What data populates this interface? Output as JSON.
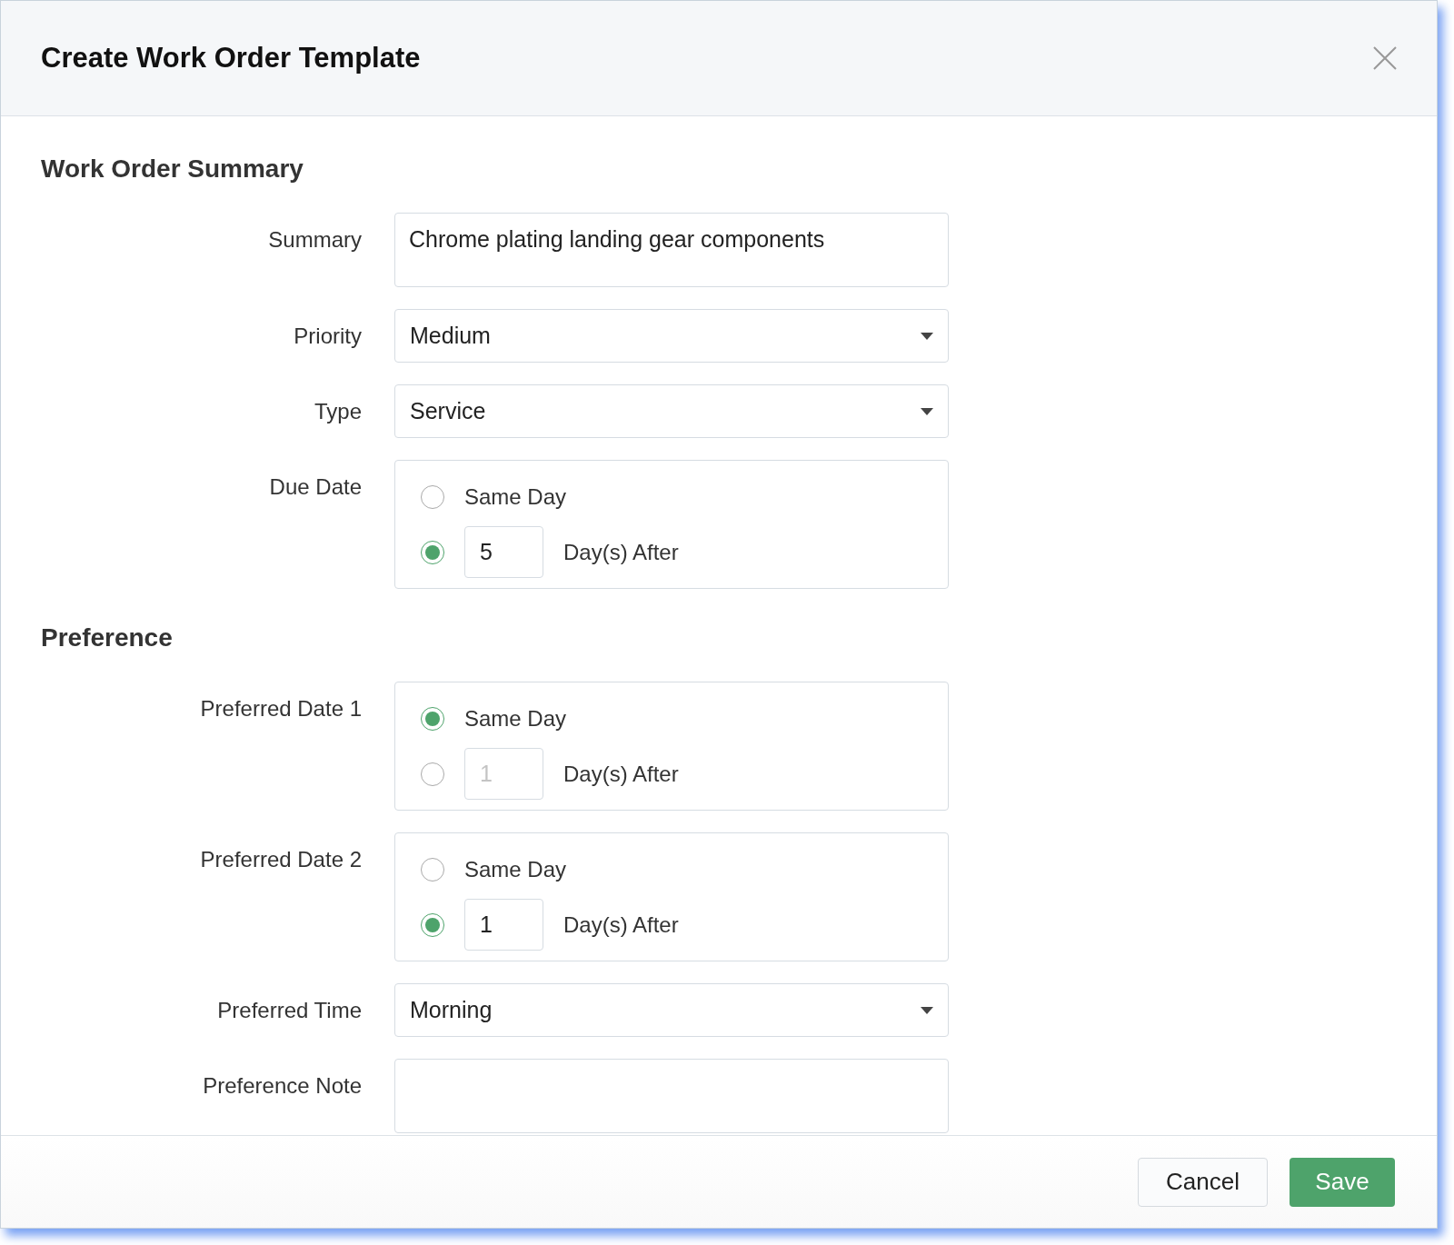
{
  "dialog": {
    "title": "Create Work Order Template",
    "sections": [
      {
        "heading": "Work Order Summary",
        "fields": [
          {
            "kind": "textarea",
            "label": "Summary",
            "value": "Chrome plating landing gear components"
          },
          {
            "kind": "select",
            "label": "Priority",
            "value": "Medium"
          },
          {
            "kind": "select",
            "label": "Type",
            "value": "Service"
          },
          {
            "kind": "date_choice",
            "label": "Due Date",
            "options": [
              {
                "kind": "same",
                "label": "Same Day",
                "selected": false
              },
              {
                "kind": "after",
                "days": "5",
                "label": "Day(s) After",
                "selected": true
              }
            ]
          }
        ]
      },
      {
        "heading": "Preference",
        "fields": [
          {
            "kind": "date_choice",
            "label": "Preferred Date 1",
            "options": [
              {
                "kind": "same",
                "label": "Same Day",
                "selected": true
              },
              {
                "kind": "after",
                "placeholder": "1",
                "label": "Day(s) After",
                "selected": false
              }
            ]
          },
          {
            "kind": "date_choice",
            "label": "Preferred Date 2",
            "options": [
              {
                "kind": "same",
                "label": "Same Day",
                "selected": false
              },
              {
                "kind": "after",
                "days": "1",
                "label": "Day(s) After",
                "selected": true
              }
            ]
          },
          {
            "kind": "select",
            "label": "Preferred Time",
            "value": "Morning"
          },
          {
            "kind": "textarea",
            "label": "Preference Note"
          }
        ]
      }
    ],
    "buttons": [
      {
        "kind": "secondary",
        "label": "Cancel"
      },
      {
        "kind": "primary",
        "label": "Save"
      }
    ]
  }
}
